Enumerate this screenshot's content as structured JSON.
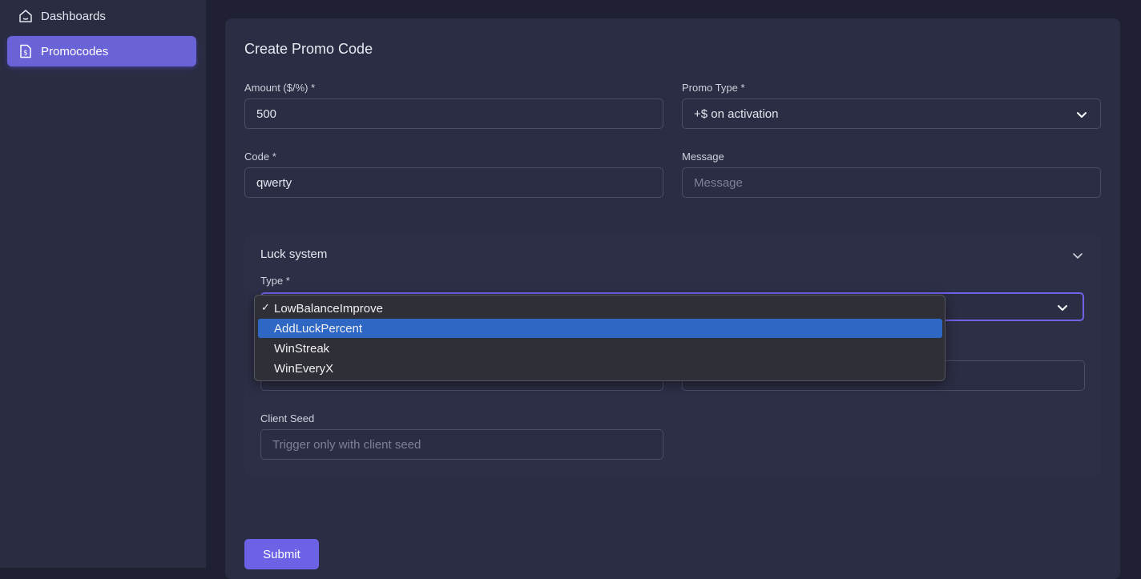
{
  "sidebar": {
    "items": [
      {
        "label": "Dashboards",
        "icon": "home-icon",
        "active": false
      },
      {
        "label": "Promocodes",
        "icon": "document-dollar-icon",
        "active": true
      }
    ]
  },
  "form": {
    "title": "Create Promo Code",
    "amount": {
      "label": "Amount ($/%) *",
      "value": "500"
    },
    "promo_type": {
      "label": "Promo Type *",
      "value": "+$ on activation"
    },
    "code": {
      "label": "Code *",
      "value": "qwerty"
    },
    "message": {
      "label": "Message",
      "placeholder": "Message"
    },
    "luck_system": {
      "title": "Luck system",
      "type_label": "Type *",
      "client_seed": {
        "label": "Client Seed",
        "placeholder": "Trigger only with client seed"
      }
    },
    "submit_label": "Submit"
  },
  "dropdown": {
    "options": [
      {
        "label": "LowBalanceImprove",
        "checked": true,
        "highlighted": false
      },
      {
        "label": "AddLuckPercent",
        "checked": false,
        "highlighted": true
      },
      {
        "label": "WinStreak",
        "checked": false,
        "highlighted": false
      },
      {
        "label": "WinEveryX",
        "checked": false,
        "highlighted": false
      }
    ],
    "check_mark": "✓"
  },
  "colors": {
    "accent": "#6c62e6",
    "highlight": "#2f68c4",
    "background": "#1f2133",
    "card": "#2b2d44"
  }
}
